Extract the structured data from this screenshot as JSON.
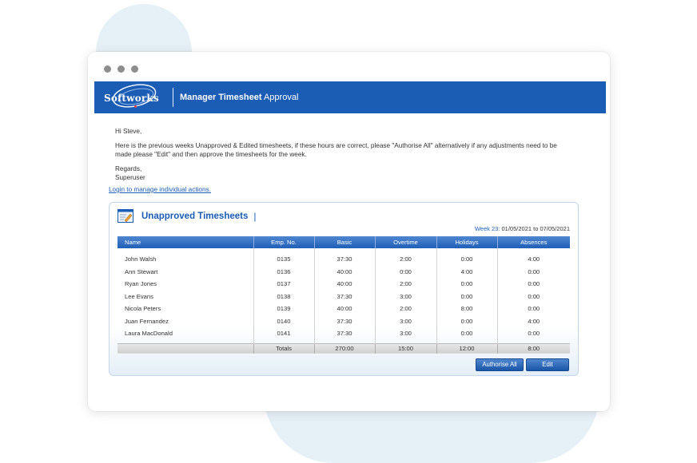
{
  "brand": {
    "logo_text": "Softworks",
    "title_bold": "Manager Timesheet",
    "title_rest": "Approval",
    "color": "#1b5db5"
  },
  "email": {
    "greeting": "Hi Steve,",
    "message": "Here is the previous weeks Unapproved & Edited timesheets, if these hours are correct, please \"Authorise All\" alternatively if any adjustments need to be made please \"Edit\" and then approve the timesheets for the week.",
    "regards": "Regards,",
    "signature": "Superuser",
    "login_link": "Login to manage individual actions."
  },
  "panel": {
    "title": "Unapproved Timesheets",
    "title_bar": "|",
    "week_label": "Week 23:",
    "week_range": "01/05/2021 to 07/05/2021",
    "icon": "timesheet-edit-icon"
  },
  "table": {
    "columns": [
      "Name",
      "Emp. No.",
      "Basic",
      "Overtime",
      "Holidays",
      "Absences"
    ],
    "rows": [
      [
        "John Walsh",
        "0135",
        "37:30",
        "2:00",
        "0:00",
        "4:00"
      ],
      [
        "Ann Stewart",
        "0136",
        "40:00",
        "0:00",
        "4:00",
        "0:00"
      ],
      [
        "Ryan Jones",
        "0137",
        "40:00",
        "2:00",
        "0:00",
        "0:00"
      ],
      [
        "Lee Evans",
        "0138",
        "37:30",
        "3:00",
        "0:00",
        "0:00"
      ],
      [
        "Nicola Peters",
        "0139",
        "40:00",
        "2:00",
        "8:00",
        "0:00"
      ],
      [
        "Juan Fernandez",
        "0140",
        "37:30",
        "3:00",
        "0:00",
        "4:00"
      ],
      [
        "Laura MacDonald",
        "0141",
        "37:30",
        "3:00",
        "0:00",
        "0:00"
      ]
    ],
    "totals": [
      "",
      "Totals",
      "270:00",
      "15:00",
      "12:00",
      "8:00"
    ]
  },
  "buttons": {
    "authorise": "Authorise All",
    "edit": "Edit"
  }
}
